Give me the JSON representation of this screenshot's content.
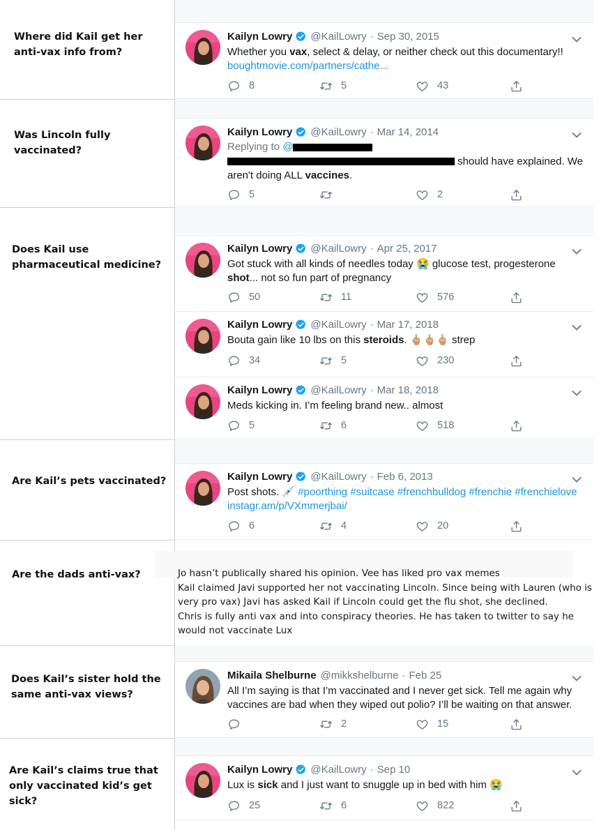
{
  "questions": [
    {
      "text": "Where did Kail get her anti-vax info from?"
    },
    {
      "text": "Was Lincoln fully vaccinated?"
    },
    {
      "text": "Does Kail use pharmaceutical medicine?"
    },
    {
      "text": "Are Kail’s pets vaccinated?"
    },
    {
      "text": "Are the dads anti-vax?"
    },
    {
      "text": "Does Kail’s sister hold the same anti-vax views?"
    },
    {
      "text": "Are Kail’s claims true that only vaccinated kid’s get sick?"
    }
  ],
  "icons": {
    "reply": "reply-icon",
    "retweet": "retweet-icon",
    "like": "like-icon",
    "share": "share-icon",
    "verified": "verified-badge-icon",
    "caret": "chevron-down-icon"
  },
  "colors": {
    "link": "#1b95e0",
    "muted": "#657786",
    "verified": "#1da1f2",
    "avatar_bg": "#e8457f"
  },
  "tweets": [
    {
      "name": "Kailyn Lowry",
      "handle": "@KailLowry",
      "date": "Sep 30, 2015",
      "text_a": "Whether you ",
      "bold_a": "vax",
      "text_b": ", select & delay, or neither check out this documentary!!",
      "link": "boughtmovie.com/partners/cathe...",
      "replies": "8",
      "retweets": "5",
      "likes": "43"
    },
    {
      "name": "Kailyn Lowry",
      "handle": "@KailLowry",
      "date": "Mar 14, 2014",
      "replying": "Replying to",
      "replying_at": "@",
      "line2_tail": "should have explained. We",
      "line3_a": "aren't doing ALL ",
      "bold_a": "vaccines",
      "line3_b": ".",
      "replies": "5",
      "retweets": "",
      "likes": "2"
    },
    {
      "name": "Kailyn Lowry",
      "handle": "@KailLowry",
      "date": "Apr 25, 2017",
      "text_a": "Got stuck with all kinds of needles today 😭 glucose test, progesterone",
      "bold_a": "shot",
      "text_b": "... not so fun part of pregnancy",
      "replies": "50",
      "retweets": "11",
      "likes": "576"
    },
    {
      "name": "Kailyn Lowry",
      "handle": "@KailLowry",
      "date": "Mar 17, 2018",
      "text_a": "Bouta gain like 10 lbs on this ",
      "bold_a": "steroids",
      "text_b": ". 🖕🏼🖕🏼🖕🏼 strep",
      "replies": "34",
      "retweets": "5",
      "likes": "230"
    },
    {
      "name": "Kailyn Lowry",
      "handle": "@KailLowry",
      "date": "Mar 18, 2018",
      "text_a": "Meds kicking in. I’m feeling brand new.. almost",
      "replies": "5",
      "retweets": "6",
      "likes": "518"
    },
    {
      "name": "Kailyn Lowry",
      "handle": "@KailLowry",
      "date": "Feb 6, 2013",
      "text_a": "Post shots. 💉",
      "hashtags": "#poorthing #suitcase #frenchbulldog #frenchie #frenchielove",
      "link": "instagr.am/p/VXmmerjbai/",
      "replies": "6",
      "retweets": "4",
      "likes": "20"
    },
    {
      "name": "Mikaila Shelburne",
      "handle": "@mikkshelburne",
      "date": "Feb 25",
      "text_a": "All I’m saying is that I’m vaccinated and I never get  sick. Tell me again why vaccines are bad when they wiped out polio? I’ll be waiting on that answer.",
      "replies": "",
      "retweets": "2",
      "likes": "15"
    },
    {
      "name": "Kailyn Lowry",
      "handle": "@KailLowry",
      "date": "Sep 10",
      "text_a": "Lux is ",
      "bold_a": "sick",
      "text_b": " and I just want to snuggle up in bed with him 😭",
      "replies": "25",
      "retweets": "6",
      "likes": "822"
    }
  ],
  "dads_note": {
    "line1": "Jo hasn’t publically shared his opinion. Vee has liked pro vax memes",
    "line2": "Kail claimed Javi supported her not vaccinating Lincoln. Since being with Lauren (who is very pro vax) Javi has asked Kail if Lincoln could get the flu shot, she declined.",
    "line3": "Chris is fully anti vax and into conspiracy theories. He has taken to twitter to say he would not vaccinate Lux"
  }
}
